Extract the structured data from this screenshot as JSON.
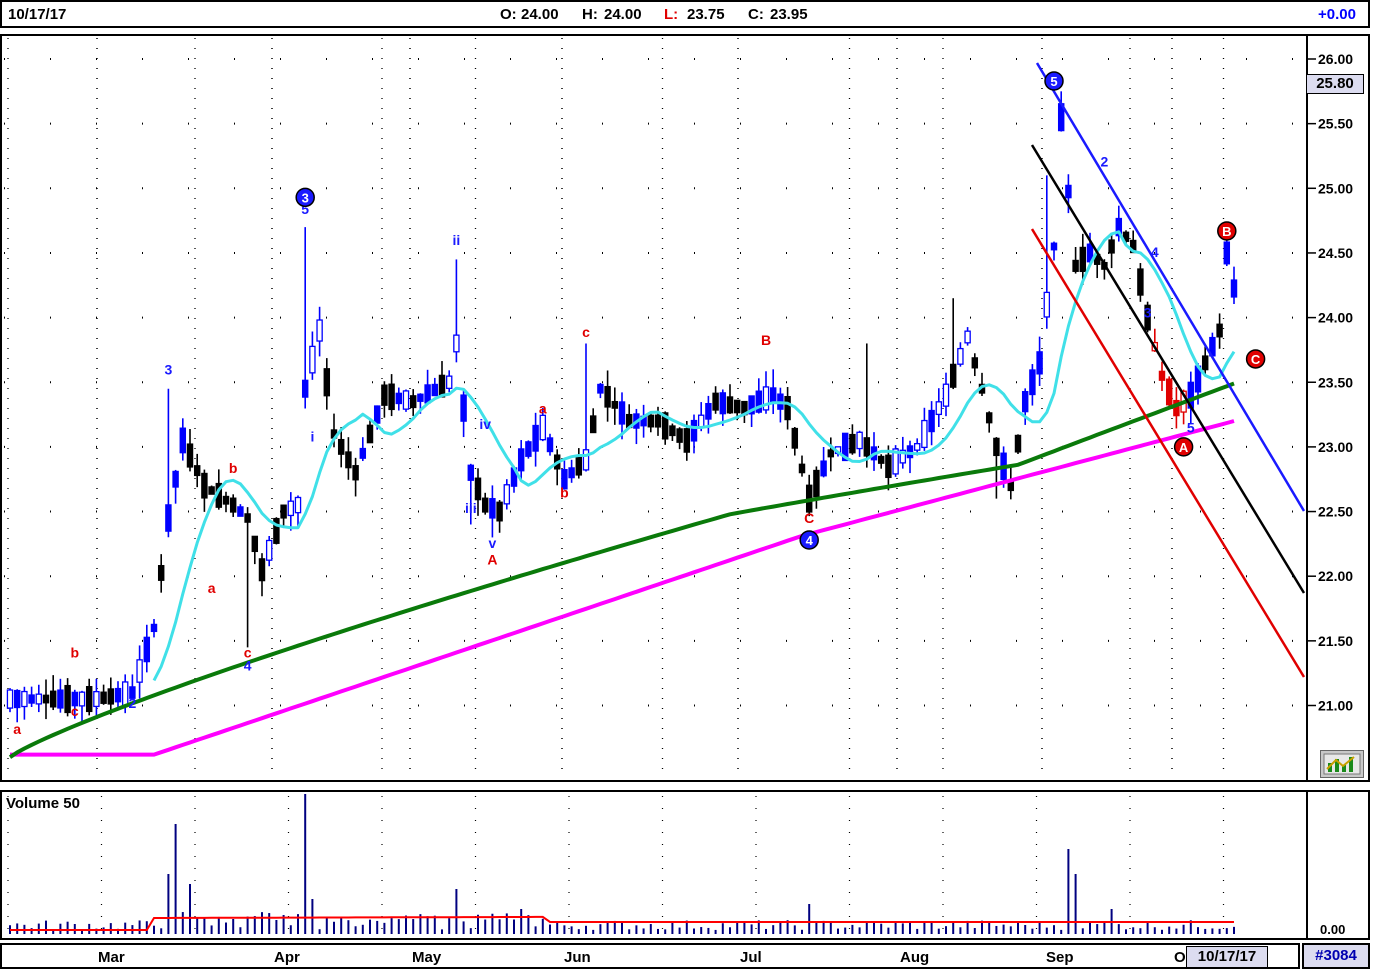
{
  "header": {
    "date": "10/17/17",
    "open_label": "O:",
    "open": "24.00",
    "high_label": "H:",
    "high": "24.00",
    "low_label": "L:",
    "low": "23.75",
    "close_label": "C:",
    "close": "23.95",
    "change": "+0.00"
  },
  "colors": {
    "up": "#0000ff",
    "down": "#000000",
    "ma_fast": "#40e0e8",
    "ma_mid": "#0a7a0a",
    "ma_slow": "#ff00ff",
    "volume": "#000080",
    "volume_avg": "#ff0000",
    "wave_blue": "#1a1aff",
    "wave_red": "#e00000",
    "grid": "#000000"
  },
  "price_badge": "25.80",
  "volume_label": "Volume 50",
  "volume_value": "0.00",
  "footer": {
    "months": [
      "Mar",
      "Apr",
      "May",
      "Jun",
      "Jul",
      "Aug",
      "Sep",
      "O"
    ],
    "date_box": "10/17/17",
    "symbol_id": "#3084"
  },
  "toolbar_icon": "chart-settings-icon",
  "chart_data": {
    "type": "candlestick",
    "y_ticks": [
      "26.00",
      "25.50",
      "25.00",
      "24.50",
      "24.00",
      "23.50",
      "23.00",
      "22.50",
      "22.00",
      "21.50",
      "21.00"
    ],
    "ylim": [
      20.55,
      26.15
    ],
    "n_bars": 171,
    "wave_labels": [
      {
        "t": "a",
        "x": 1,
        "y": 20.78,
        "c": "red"
      },
      {
        "t": "b",
        "x": 9,
        "y": 21.37,
        "c": "red"
      },
      {
        "t": "c",
        "x": 9,
        "y": 20.92,
        "c": "red"
      },
      {
        "t": "2",
        "x": 17,
        "y": 20.98,
        "c": "blue"
      },
      {
        "t": "3",
        "x": 22,
        "y": 23.56,
        "c": "blue"
      },
      {
        "t": "b",
        "x": 31,
        "y": 22.8,
        "c": "red"
      },
      {
        "t": "a",
        "x": 28,
        "y": 21.87,
        "c": "red"
      },
      {
        "t": "c",
        "x": 33,
        "y": 21.37,
        "c": "red"
      },
      {
        "t": "4",
        "x": 33,
        "y": 21.27,
        "c": "blue"
      },
      {
        "t": "5",
        "x": 41,
        "y": 24.8,
        "c": "blue"
      },
      {
        "t": "i",
        "x": 42,
        "y": 23.04,
        "c": "blue"
      },
      {
        "t": "ii",
        "x": 62,
        "y": 24.56,
        "c": "blue"
      },
      {
        "t": "iv",
        "x": 66,
        "y": 23.14,
        "c": "blue"
      },
      {
        "t": "iii",
        "x": 64,
        "y": 22.49,
        "c": "blue"
      },
      {
        "t": "v",
        "x": 67,
        "y": 22.22,
        "c": "blue"
      },
      {
        "t": "A",
        "x": 67,
        "y": 22.09,
        "c": "red"
      },
      {
        "t": "a",
        "x": 74,
        "y": 23.26,
        "c": "red"
      },
      {
        "t": "b",
        "x": 77,
        "y": 22.61,
        "c": "red"
      },
      {
        "t": "c",
        "x": 80,
        "y": 23.85,
        "c": "red"
      },
      {
        "t": "B",
        "x": 105,
        "y": 23.79,
        "c": "red"
      },
      {
        "t": "C",
        "x": 111,
        "y": 22.41,
        "c": "red"
      },
      {
        "t": "2",
        "x": 152,
        "y": 25.17,
        "c": "blue"
      },
      {
        "t": "4",
        "x": 159,
        "y": 24.47,
        "c": "blue"
      },
      {
        "t": "3",
        "x": 158,
        "y": 24.0,
        "c": "blue"
      },
      {
        "t": "5",
        "x": 164,
        "y": 23.11,
        "c": "blue"
      }
    ],
    "circle_labels": [
      {
        "t": "3",
        "x": 41,
        "y": 24.93,
        "c": "blue"
      },
      {
        "t": "4",
        "x": 111,
        "y": 22.28,
        "c": "blue"
      },
      {
        "t": "5",
        "x": 145,
        "y": 25.83,
        "c": "blue"
      },
      {
        "t": "B",
        "x": 169,
        "y": 24.67,
        "c": "red"
      },
      {
        "t": "A",
        "x": 163,
        "y": 23.0,
        "c": "red"
      },
      {
        "t": "C",
        "x": 173,
        "y": 23.68,
        "c": "red"
      }
    ]
  }
}
